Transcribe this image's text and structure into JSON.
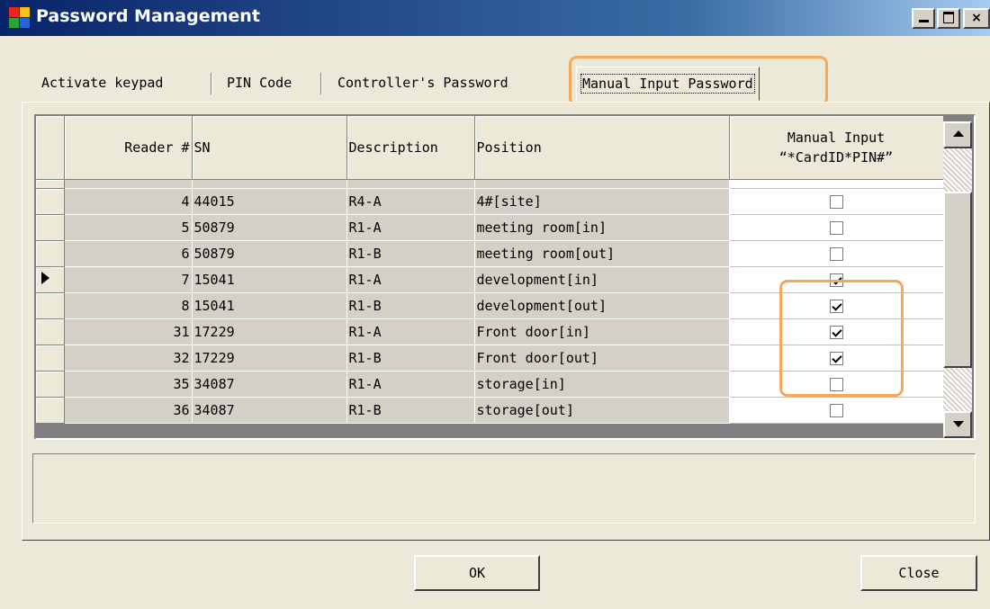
{
  "window": {
    "title": "Password Management",
    "controls": {
      "minimize": "minimize-icon",
      "maximize": "maximize-icon",
      "close": "close-icon",
      "close_glyph": "×"
    }
  },
  "tabs": [
    {
      "label": "Activate keypad",
      "active": false
    },
    {
      "label": "PIN Code",
      "active": false
    },
    {
      "label": "Controller's Password",
      "active": false
    },
    {
      "label": "Manual Input Password",
      "active": true
    }
  ],
  "grid": {
    "columns": {
      "reader": "Reader #",
      "sn": "SN",
      "description": "Description",
      "position": "Position",
      "manual_line1": "Manual Input",
      "manual_line2": "“*CardID*PIN#”"
    },
    "rows": [
      {
        "reader": "4",
        "sn": "44015",
        "description": "R4-A",
        "position": "4#[site]",
        "manual": false,
        "current": false
      },
      {
        "reader": "5",
        "sn": "50879",
        "description": "R1-A",
        "position": "meeting room[in]",
        "manual": false,
        "current": false
      },
      {
        "reader": "6",
        "sn": "50879",
        "description": "R1-B",
        "position": "meeting room[out]",
        "manual": false,
        "current": false
      },
      {
        "reader": "7",
        "sn": "15041",
        "description": "R1-A",
        "position": "development[in]",
        "manual": true,
        "current": true
      },
      {
        "reader": "8",
        "sn": "15041",
        "description": "R1-B",
        "position": "development[out]",
        "manual": true,
        "current": false
      },
      {
        "reader": "31",
        "sn": "17229",
        "description": "R1-A",
        "position": "Front door[in]",
        "manual": true,
        "current": false
      },
      {
        "reader": "32",
        "sn": "17229",
        "description": "R1-B",
        "position": "Front door[out]",
        "manual": true,
        "current": false
      },
      {
        "reader": "35",
        "sn": "34087",
        "description": "R1-A",
        "position": "storage[in]",
        "manual": false,
        "current": false
      },
      {
        "reader": "36",
        "sn": "34087",
        "description": "R1-B",
        "position": "storage[out]",
        "manual": false,
        "current": false
      }
    ]
  },
  "buttons": {
    "ok": "OK",
    "close": "Close"
  },
  "colors": {
    "highlight": "#f7a75a",
    "title_bar": "#0a246a",
    "face": "#ece9d8"
  }
}
